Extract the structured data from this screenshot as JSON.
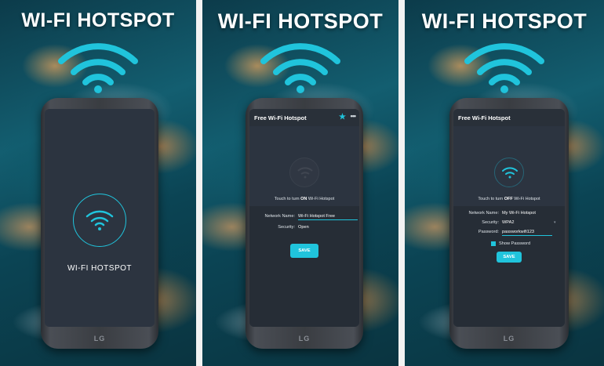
{
  "headline": "WI-FI HOTSPOT",
  "accent_color": "#20c4dc",
  "screen1": {
    "label": "WI-FI HOTSPOT"
  },
  "screen2": {
    "title": "Free Wi-Fi Hotspot",
    "star_icon": "star-icon",
    "more_icon": "more-icon",
    "touch_prefix": "Touch to turn ",
    "touch_state": "ON",
    "touch_suffix": " Wi-Fi Hotspot",
    "network_label": "Network Name:",
    "network_value": "Wi-Fi Hotspot Free",
    "security_label": "Security:",
    "security_value": "Open",
    "save_label": "SAVE"
  },
  "screen3": {
    "title": "Free Wi-Fi Hotspot",
    "touch_prefix": "Touch to turn ",
    "touch_state": "OFF",
    "touch_suffix": " Wi-Fi Hotspot",
    "network_label": "Network Name:",
    "network_value": "My Wi-Fi Hotspot",
    "security_label": "Security:",
    "security_value": "WPA2",
    "password_label": "Password:",
    "password_value": "passworkwifi123",
    "show_password_label": "Show Password",
    "save_label": "SAVE"
  },
  "phone_brand": "LG"
}
